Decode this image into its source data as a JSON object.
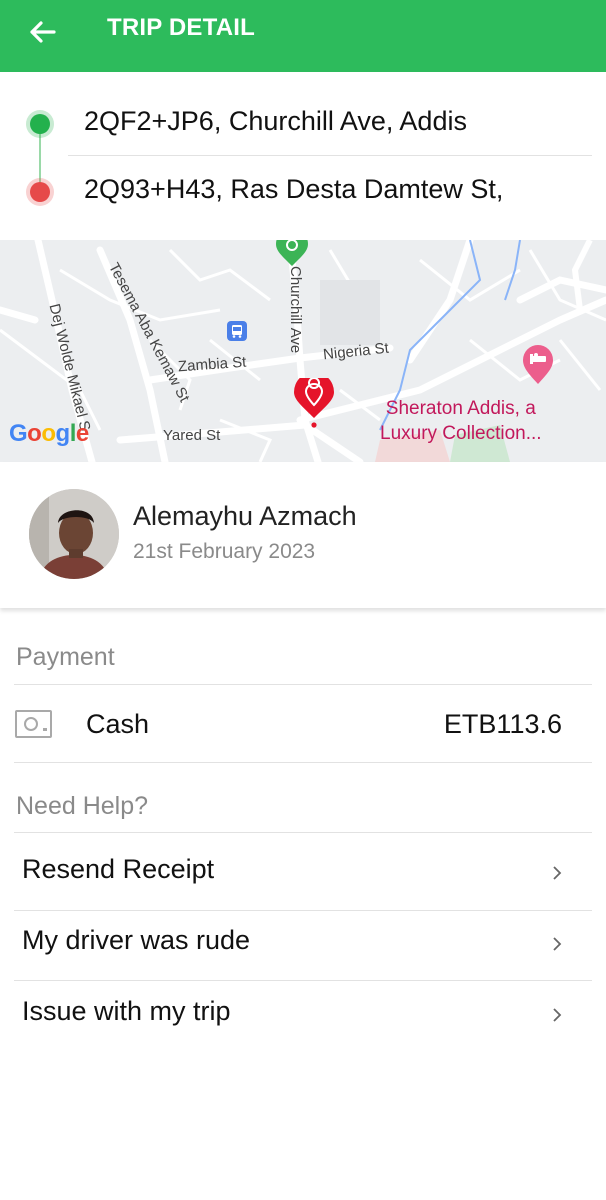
{
  "header": {
    "title": "TRIP DETAIL",
    "back_icon": "arrow-left-icon",
    "color": "#2dbb5c"
  },
  "route": {
    "pickup": "2QF2+JP6, Churchill Ave, Addis",
    "dropoff": "2Q93+H43, Ras Desta Damtew St,"
  },
  "map": {
    "streets": {
      "dej_wolde": "Dej Wolde Mikael S",
      "tesema": "Tesema Aba Kemaw St",
      "churchill": "Churchill Ave",
      "zambia": "Zambia St",
      "nigeria": "Nigeria St",
      "yared": "Yared St"
    },
    "place": "Sheraton Addis, a",
    "place_line2": "Luxury Collection...",
    "logo": "Google"
  },
  "driver": {
    "name": "Alemayhu Azmach",
    "date": "21st February 2023"
  },
  "payment": {
    "title": "Payment",
    "method": "Cash",
    "amount": "ETB113.6"
  },
  "help": {
    "title": "Need Help?",
    "items": [
      {
        "label": "Resend Receipt"
      },
      {
        "label": "My driver was rude"
      },
      {
        "label": "Issue with my trip"
      }
    ]
  }
}
